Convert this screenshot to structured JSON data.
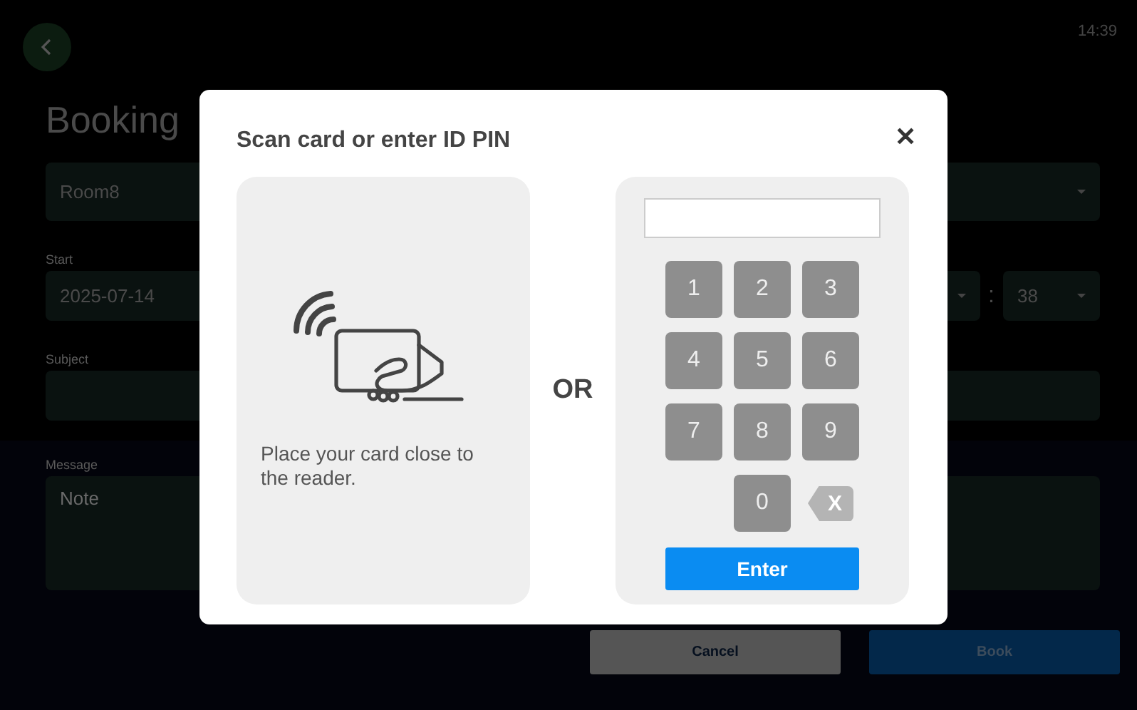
{
  "status_bar": {
    "time": "14:39"
  },
  "form": {
    "title": "Booking",
    "room": {
      "value": "Room8"
    },
    "start": {
      "label": "Start",
      "date": "2025-07-14",
      "separator": ":",
      "minute": "38"
    },
    "subject": {
      "label": "Subject"
    },
    "message": {
      "label": "Message",
      "placeholder": "Note"
    },
    "buttons": [
      {
        "label": "Cancel",
        "kind": "secondary"
      },
      {
        "label": "Book",
        "kind": "primary"
      }
    ]
  },
  "dialog": {
    "title": "Scan card or enter ID PIN",
    "close": "✕",
    "card_panel": {
      "instruction": "Place your card close to the reader."
    },
    "separator": "OR",
    "pin_panel": {
      "keys": [
        {
          "label": "1",
          "kind": "digit"
        },
        {
          "label": "2",
          "kind": "digit"
        },
        {
          "label": "3",
          "kind": "digit"
        },
        {
          "label": "4",
          "kind": "digit"
        },
        {
          "label": "5",
          "kind": "digit"
        },
        {
          "label": "6",
          "kind": "digit"
        },
        {
          "label": "7",
          "kind": "digit"
        },
        {
          "label": "8",
          "kind": "digit"
        },
        {
          "label": "9",
          "kind": "digit"
        },
        {
          "label": "0",
          "kind": "digit"
        },
        {
          "label": "X",
          "kind": "backspace"
        }
      ],
      "submit": "Enter"
    }
  }
}
